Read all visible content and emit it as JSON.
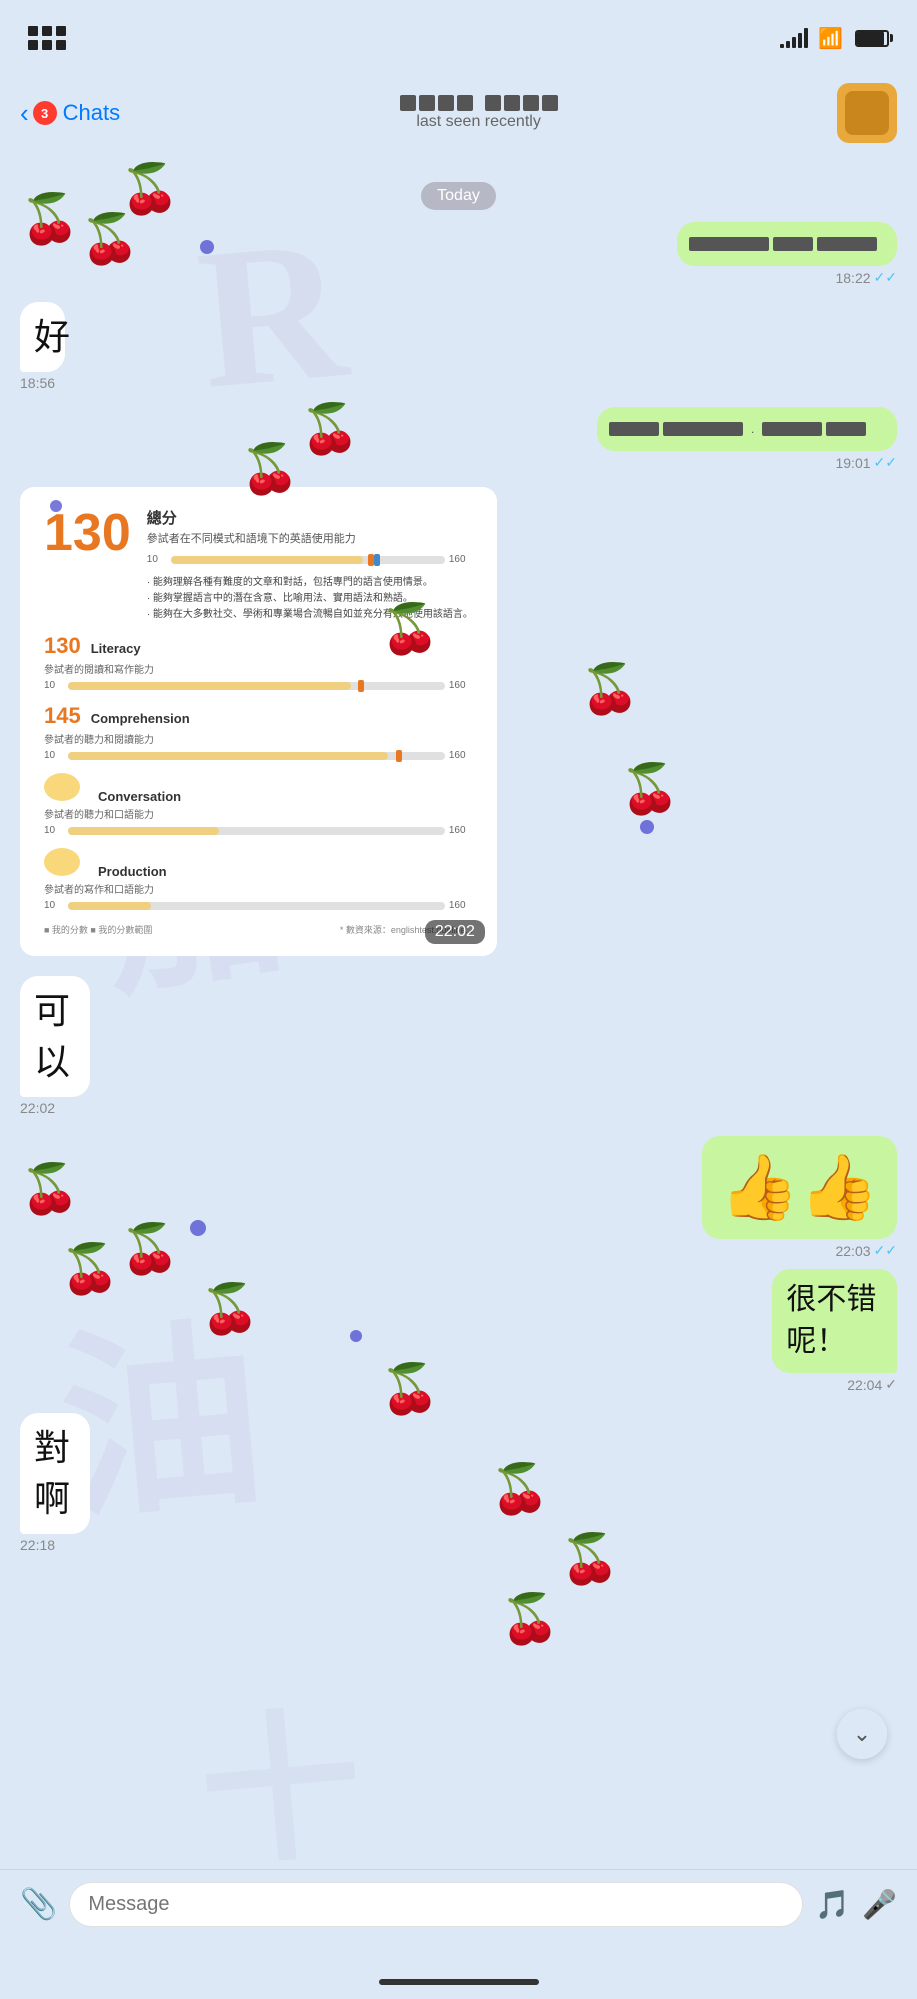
{
  "statusBar": {
    "signal": [
      4,
      8,
      12,
      16,
      20
    ],
    "wifi": "📶",
    "battery": "🔋"
  },
  "navBar": {
    "backLabel": "Chats",
    "badgeCount": "3",
    "contactName": "████ ████",
    "lastSeen": "last seen recently"
  },
  "dateSeparator": "Today",
  "messages": [
    {
      "id": "m1",
      "type": "outgoing-redacted",
      "time": "18:22",
      "ticks": "✓✓"
    },
    {
      "id": "m2",
      "type": "incoming-text",
      "text": "好",
      "time": "18:56"
    },
    {
      "id": "m3",
      "type": "outgoing-redacted2",
      "time": "19:01",
      "ticks": "✓✓"
    },
    {
      "id": "m4",
      "type": "image",
      "time": "22:02",
      "scoreData": {
        "total": "130",
        "totalLabel": "總分",
        "totalDesc": "參試者在不同模式和語境下的英語使用能力",
        "scaleMin": "10",
        "scaleMax": "160",
        "bullets": [
          "· 能夠理解各種有難度的文章和對話，包括專門的語言使用情景。",
          "· 能夠掌握語言中的潛在含意、比喻用法、實用語法和熟語。",
          "· 能夠在大多數社交、學術和專業場合流暢自如並充分有效地使用該語言。"
        ],
        "subscores": [
          {
            "num": "130",
            "name": "Literacy",
            "sub": "參試者的閱讀和寫作能力",
            "fillPct": 78
          },
          {
            "num": "145",
            "name": "Comprehension",
            "sub": "參試者的聽力和閱讀能力",
            "fillPct": 88
          },
          {
            "num": "",
            "name": "Conversation",
            "sub": "參試者的聽力和口語能力",
            "fillPct": 50
          },
          {
            "num": "",
            "name": "Production",
            "sub": "參試者的寫作和口語能力",
            "fillPct": 30
          }
        ],
        "legend": "■ 我的分數  ■ 我的分數範圍",
        "source": "* 數資來源：englishtest.duoline..."
      }
    },
    {
      "id": "m5",
      "type": "incoming-text",
      "text": "可以",
      "time": "22:02"
    },
    {
      "id": "m6",
      "type": "outgoing-emoji",
      "emoji": "👍👍",
      "time": "22:03",
      "ticks": "✓✓"
    },
    {
      "id": "m7",
      "type": "outgoing-text",
      "text": "很不错呢！",
      "time": "22:04",
      "ticks": "✓"
    },
    {
      "id": "m8",
      "type": "incoming-text",
      "text": "對啊",
      "time": "22:18"
    }
  ],
  "inputBar": {
    "placeholder": "Message",
    "attachIcon": "📎",
    "emojiIcon": "🎵",
    "micIcon": "🎤"
  },
  "scrollDown": "⌄",
  "colors": {
    "outgoingBubble": "#c8f5a0",
    "incomingBubble": "#ffffff",
    "accent": "#007aff",
    "background": "#dce8f5"
  }
}
